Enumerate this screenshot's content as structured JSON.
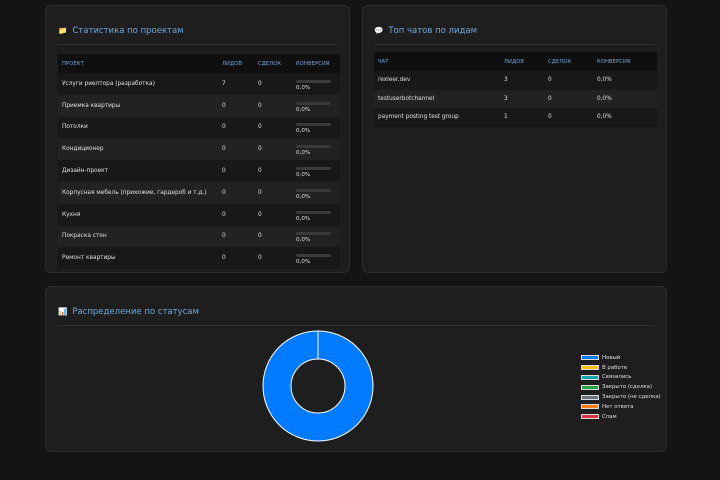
{
  "projects_card": {
    "title": "Статистика по проектам",
    "icon": "folder-icon",
    "columns": [
      "Проект",
      "Лидов",
      "Сделок",
      "Конверсия"
    ],
    "rows": [
      {
        "name": "Услуги риелтора (разработка)",
        "leads": "7",
        "deals": "0",
        "conversion": "0,0%",
        "conversion_fraction": 0
      },
      {
        "name": "Приемка квартиры",
        "leads": "0",
        "deals": "0",
        "conversion": "0,0%",
        "conversion_fraction": 0
      },
      {
        "name": "Потолки",
        "leads": "0",
        "deals": "0",
        "conversion": "0,0%",
        "conversion_fraction": 0
      },
      {
        "name": "Кондиционер",
        "leads": "0",
        "deals": "0",
        "conversion": "0,0%",
        "conversion_fraction": 0
      },
      {
        "name": "Дизайн-проект",
        "leads": "0",
        "deals": "0",
        "conversion": "0,0%",
        "conversion_fraction": 0
      },
      {
        "name": "Корпусная мебель (прихожие, гардероб и т.д.)",
        "leads": "0",
        "deals": "0",
        "conversion": "0,0%",
        "conversion_fraction": 0
      },
      {
        "name": "Кухня",
        "leads": "0",
        "deals": "0",
        "conversion": "0,0%",
        "conversion_fraction": 0
      },
      {
        "name": "Покраска стен",
        "leads": "0",
        "deals": "0",
        "conversion": "0,0%",
        "conversion_fraction": 0
      },
      {
        "name": "Ремонт квартиры",
        "leads": "0",
        "deals": "0",
        "conversion": "0,0%",
        "conversion_fraction": 0
      }
    ]
  },
  "chats_card": {
    "title": "Топ чатов по лидам",
    "icon": "chat-bubble-icon",
    "columns": [
      "Чат",
      "Лидов",
      "Сделок",
      "Конверсия"
    ],
    "rows": [
      {
        "name": "rexleer.dev",
        "leads": "3",
        "deals": "0",
        "conversion": "0,0%"
      },
      {
        "name": "testuserbotchannel",
        "leads": "3",
        "deals": "0",
        "conversion": "0,0%"
      },
      {
        "name": "payment posting test group",
        "leads": "1",
        "deals": "0",
        "conversion": "0,0%"
      }
    ]
  },
  "status_card": {
    "title": "Распределение по статусам",
    "icon": "bar-chart-icon",
    "legend": [
      {
        "label": "Новый",
        "color": "#007bff",
        "value": 7
      },
      {
        "label": "В работе",
        "color": "#ffc107",
        "value": 0
      },
      {
        "label": "Связались",
        "color": "#17a2b8",
        "value": 0
      },
      {
        "label": "Закрыто (сделка)",
        "color": "#28a745",
        "value": 0
      },
      {
        "label": "Закрыто (не сделка)",
        "color": "#6c757d",
        "value": 0
      },
      {
        "label": "Нет ответа",
        "color": "#fd7e14",
        "value": 0
      },
      {
        "label": "Спам",
        "color": "#dc3545",
        "value": 0
      }
    ]
  },
  "colors": {
    "accent": "#6fa8dc",
    "bar_fill": "#007bff",
    "card_bg": "#1e1e1e",
    "page_bg": "#141414"
  }
}
